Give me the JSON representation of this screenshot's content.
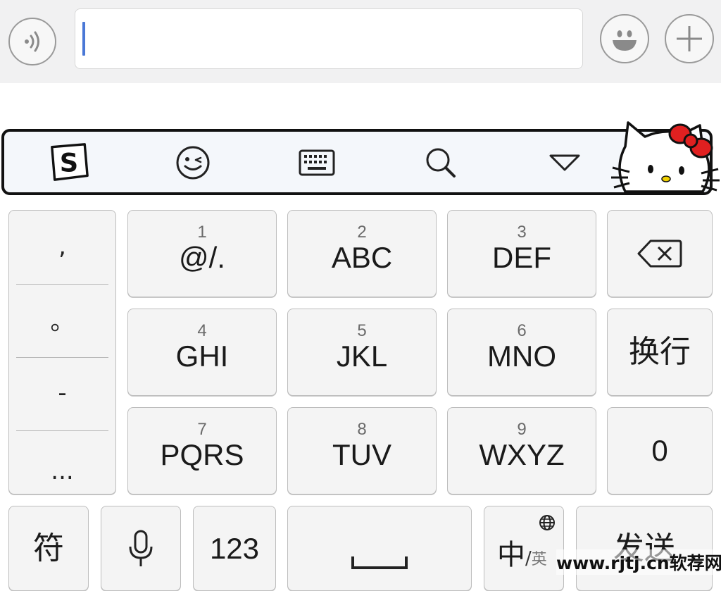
{
  "compose": {
    "voice_icon": "voice-wave-icon",
    "emoji_icon": "smiley-face-icon",
    "plus_icon": "plus-icon",
    "input_value": ""
  },
  "toolbar": {
    "logo_icon": "sogou-s-logo-icon",
    "emoji_icon": "wink-emoji-icon",
    "keyboard_icon": "keyboard-icon",
    "search_icon": "search-icon",
    "collapse_icon": "triangle-down-icon",
    "mascot": "hello-kitty-skin"
  },
  "keyboard": {
    "punctuation": [
      ",",
      "。",
      "-",
      "..."
    ],
    "keys": [
      {
        "num": "1",
        "label": "@/."
      },
      {
        "num": "2",
        "label": "ABC"
      },
      {
        "num": "3",
        "label": "DEF"
      },
      {
        "num": "4",
        "label": "GHI"
      },
      {
        "num": "5",
        "label": "JKL"
      },
      {
        "num": "6",
        "label": "MNO"
      },
      {
        "num": "7",
        "label": "PQRS"
      },
      {
        "num": "8",
        "label": "TUV"
      },
      {
        "num": "9",
        "label": "WXYZ"
      }
    ],
    "backspace_icon": "backspace-icon",
    "newline_label": "换行",
    "zero_label": "0",
    "symbol_label": "符",
    "mic_icon": "microphone-icon",
    "numbers_label": "123",
    "space_icon": "space-bar-icon",
    "lang_main": "中",
    "lang_sep": "/",
    "lang_alt": "英",
    "globe_icon": "globe-icon",
    "send_label": "发送"
  },
  "watermark": "www.rjtj.cn软荐网",
  "colors": {
    "caret": "#4a78d6",
    "bow": "#e02020"
  }
}
